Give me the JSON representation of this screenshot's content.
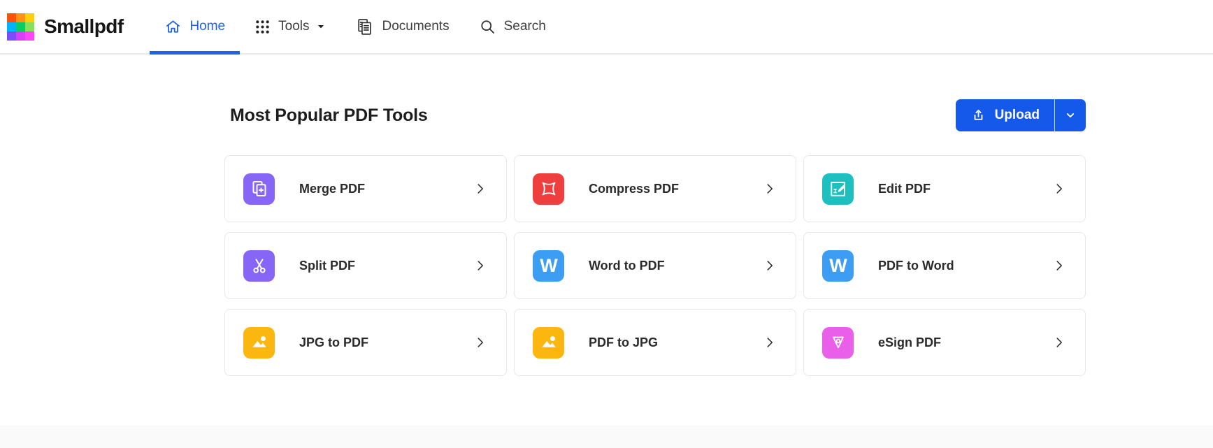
{
  "brand": {
    "name": "Smallpdf",
    "logo_colors": [
      "#FF5208",
      "#FF9313",
      "#FFCE0A",
      "#00B3FF",
      "#0ACC65",
      "#86E05A",
      "#7C4DFF",
      "#D93FF5",
      "#FF45F8"
    ]
  },
  "nav": {
    "items": [
      {
        "label": "Home",
        "icon": "home-icon",
        "active": true
      },
      {
        "label": "Tools",
        "icon": "grid-icon",
        "has_dropdown": true
      },
      {
        "label": "Documents",
        "icon": "documents-icon"
      },
      {
        "label": "Search",
        "icon": "search-icon"
      }
    ]
  },
  "main": {
    "title": "Most Popular PDF Tools",
    "upload": {
      "label": "Upload",
      "color": "#1459EA"
    },
    "tools": [
      {
        "label": "Merge PDF",
        "icon": "merge-pdf-icon",
        "color": "#8765F6"
      },
      {
        "label": "Compress PDF",
        "icon": "compress-pdf-icon",
        "color": "#EF3E3E"
      },
      {
        "label": "Edit PDF",
        "icon": "edit-pdf-icon",
        "color": "#1EBFBF"
      },
      {
        "label": "Split PDF",
        "icon": "split-pdf-icon",
        "color": "#8765F6"
      },
      {
        "label": "Word to PDF",
        "icon": "word-icon",
        "color": "#3D9DF3",
        "glyph": "W"
      },
      {
        "label": "PDF to Word",
        "icon": "word-icon",
        "color": "#3D9DF3",
        "glyph": "W"
      },
      {
        "label": "JPG to PDF",
        "icon": "image-icon",
        "color": "#FBB710"
      },
      {
        "label": "PDF to JPG",
        "icon": "image-icon",
        "color": "#FBB710"
      },
      {
        "label": "eSign PDF",
        "icon": "esign-pdf-icon",
        "color": "#E95FE9"
      }
    ]
  },
  "colors": {
    "nav_active": "#1F62E9",
    "accent": "#1459EA",
    "card_border": "#E7E7E7",
    "footer_bg": "#FAFAFA"
  }
}
